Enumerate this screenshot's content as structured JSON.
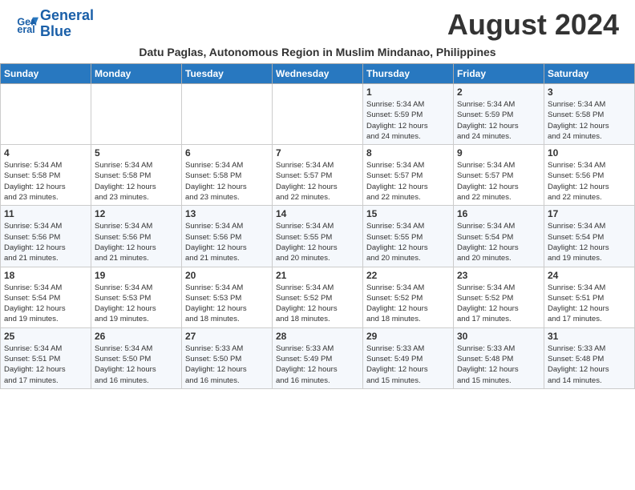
{
  "header": {
    "logo_line1": "General",
    "logo_line2": "Blue",
    "month_title": "August 2024",
    "subtitle": "Datu Paglas, Autonomous Region in Muslim Mindanao, Philippines"
  },
  "weekdays": [
    "Sunday",
    "Monday",
    "Tuesday",
    "Wednesday",
    "Thursday",
    "Friday",
    "Saturday"
  ],
  "weeks": [
    [
      {
        "day": "",
        "info": ""
      },
      {
        "day": "",
        "info": ""
      },
      {
        "day": "",
        "info": ""
      },
      {
        "day": "",
        "info": ""
      },
      {
        "day": "1",
        "info": "Sunrise: 5:34 AM\nSunset: 5:59 PM\nDaylight: 12 hours\nand 24 minutes."
      },
      {
        "day": "2",
        "info": "Sunrise: 5:34 AM\nSunset: 5:59 PM\nDaylight: 12 hours\nand 24 minutes."
      },
      {
        "day": "3",
        "info": "Sunrise: 5:34 AM\nSunset: 5:58 PM\nDaylight: 12 hours\nand 24 minutes."
      }
    ],
    [
      {
        "day": "4",
        "info": "Sunrise: 5:34 AM\nSunset: 5:58 PM\nDaylight: 12 hours\nand 23 minutes."
      },
      {
        "day": "5",
        "info": "Sunrise: 5:34 AM\nSunset: 5:58 PM\nDaylight: 12 hours\nand 23 minutes."
      },
      {
        "day": "6",
        "info": "Sunrise: 5:34 AM\nSunset: 5:58 PM\nDaylight: 12 hours\nand 23 minutes."
      },
      {
        "day": "7",
        "info": "Sunrise: 5:34 AM\nSunset: 5:57 PM\nDaylight: 12 hours\nand 22 minutes."
      },
      {
        "day": "8",
        "info": "Sunrise: 5:34 AM\nSunset: 5:57 PM\nDaylight: 12 hours\nand 22 minutes."
      },
      {
        "day": "9",
        "info": "Sunrise: 5:34 AM\nSunset: 5:57 PM\nDaylight: 12 hours\nand 22 minutes."
      },
      {
        "day": "10",
        "info": "Sunrise: 5:34 AM\nSunset: 5:56 PM\nDaylight: 12 hours\nand 22 minutes."
      }
    ],
    [
      {
        "day": "11",
        "info": "Sunrise: 5:34 AM\nSunset: 5:56 PM\nDaylight: 12 hours\nand 21 minutes."
      },
      {
        "day": "12",
        "info": "Sunrise: 5:34 AM\nSunset: 5:56 PM\nDaylight: 12 hours\nand 21 minutes."
      },
      {
        "day": "13",
        "info": "Sunrise: 5:34 AM\nSunset: 5:56 PM\nDaylight: 12 hours\nand 21 minutes."
      },
      {
        "day": "14",
        "info": "Sunrise: 5:34 AM\nSunset: 5:55 PM\nDaylight: 12 hours\nand 20 minutes."
      },
      {
        "day": "15",
        "info": "Sunrise: 5:34 AM\nSunset: 5:55 PM\nDaylight: 12 hours\nand 20 minutes."
      },
      {
        "day": "16",
        "info": "Sunrise: 5:34 AM\nSunset: 5:54 PM\nDaylight: 12 hours\nand 20 minutes."
      },
      {
        "day": "17",
        "info": "Sunrise: 5:34 AM\nSunset: 5:54 PM\nDaylight: 12 hours\nand 19 minutes."
      }
    ],
    [
      {
        "day": "18",
        "info": "Sunrise: 5:34 AM\nSunset: 5:54 PM\nDaylight: 12 hours\nand 19 minutes."
      },
      {
        "day": "19",
        "info": "Sunrise: 5:34 AM\nSunset: 5:53 PM\nDaylight: 12 hours\nand 19 minutes."
      },
      {
        "day": "20",
        "info": "Sunrise: 5:34 AM\nSunset: 5:53 PM\nDaylight: 12 hours\nand 18 minutes."
      },
      {
        "day": "21",
        "info": "Sunrise: 5:34 AM\nSunset: 5:52 PM\nDaylight: 12 hours\nand 18 minutes."
      },
      {
        "day": "22",
        "info": "Sunrise: 5:34 AM\nSunset: 5:52 PM\nDaylight: 12 hours\nand 18 minutes."
      },
      {
        "day": "23",
        "info": "Sunrise: 5:34 AM\nSunset: 5:52 PM\nDaylight: 12 hours\nand 17 minutes."
      },
      {
        "day": "24",
        "info": "Sunrise: 5:34 AM\nSunset: 5:51 PM\nDaylight: 12 hours\nand 17 minutes."
      }
    ],
    [
      {
        "day": "25",
        "info": "Sunrise: 5:34 AM\nSunset: 5:51 PM\nDaylight: 12 hours\nand 17 minutes."
      },
      {
        "day": "26",
        "info": "Sunrise: 5:34 AM\nSunset: 5:50 PM\nDaylight: 12 hours\nand 16 minutes."
      },
      {
        "day": "27",
        "info": "Sunrise: 5:33 AM\nSunset: 5:50 PM\nDaylight: 12 hours\nand 16 minutes."
      },
      {
        "day": "28",
        "info": "Sunrise: 5:33 AM\nSunset: 5:49 PM\nDaylight: 12 hours\nand 16 minutes."
      },
      {
        "day": "29",
        "info": "Sunrise: 5:33 AM\nSunset: 5:49 PM\nDaylight: 12 hours\nand 15 minutes."
      },
      {
        "day": "30",
        "info": "Sunrise: 5:33 AM\nSunset: 5:48 PM\nDaylight: 12 hours\nand 15 minutes."
      },
      {
        "day": "31",
        "info": "Sunrise: 5:33 AM\nSunset: 5:48 PM\nDaylight: 12 hours\nand 14 minutes."
      }
    ]
  ]
}
